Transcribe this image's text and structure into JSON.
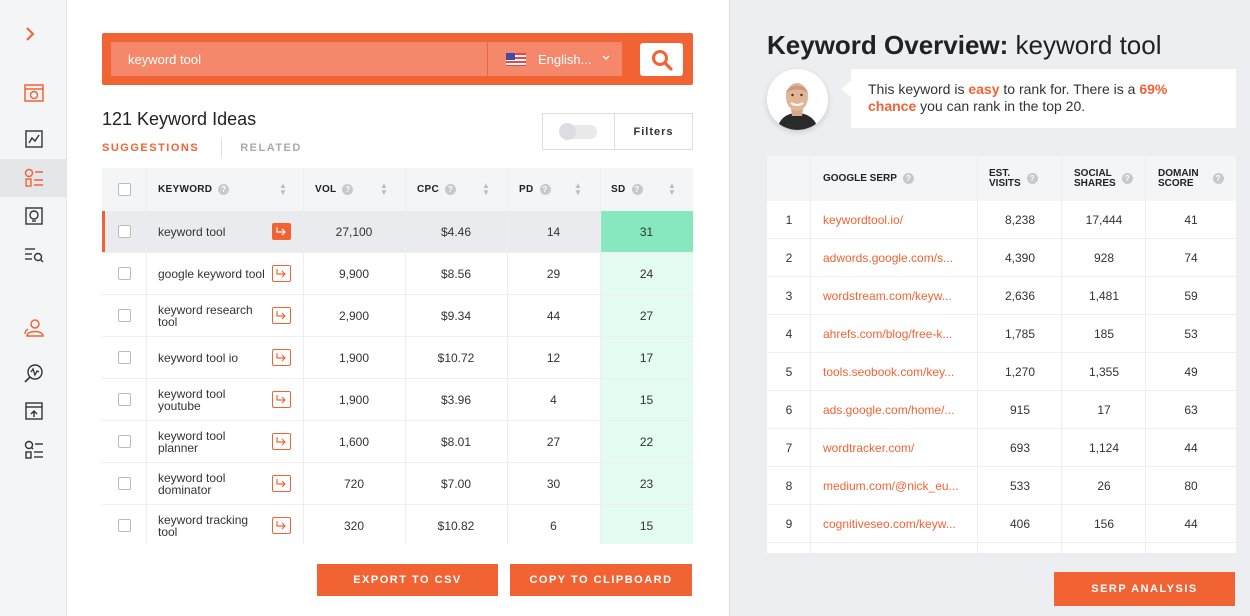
{
  "search": {
    "value": "keyword tool",
    "language": "English..."
  },
  "ideas": {
    "title": "121 Keyword Ideas",
    "tab_suggestions": "SUGGESTIONS",
    "tab_related": "RELATED",
    "filters_label": "Filters"
  },
  "table": {
    "headers": {
      "keyword": "KEYWORD",
      "vol": "VOL",
      "cpc": "CPC",
      "pd": "PD",
      "sd": "SD"
    },
    "rows": [
      {
        "keyword": "keyword tool",
        "vol": "27,100",
        "cpc": "$4.46",
        "pd": "14",
        "sd": "31"
      },
      {
        "keyword": "google keyword tool",
        "vol": "9,900",
        "cpc": "$8.56",
        "pd": "29",
        "sd": "24"
      },
      {
        "keyword": "keyword research tool",
        "vol": "2,900",
        "cpc": "$9.34",
        "pd": "44",
        "sd": "27"
      },
      {
        "keyword": "keyword tool io",
        "vol": "1,900",
        "cpc": "$10.72",
        "pd": "12",
        "sd": "17"
      },
      {
        "keyword": "keyword tool youtube",
        "vol": "1,900",
        "cpc": "$3.96",
        "pd": "4",
        "sd": "15"
      },
      {
        "keyword": "keyword tool planner",
        "vol": "1,600",
        "cpc": "$8.01",
        "pd": "27",
        "sd": "22"
      },
      {
        "keyword": "keyword tool dominator",
        "vol": "720",
        "cpc": "$7.00",
        "pd": "30",
        "sd": "23"
      },
      {
        "keyword": "keyword tracking tool",
        "vol": "320",
        "cpc": "$10.82",
        "pd": "6",
        "sd": "15"
      }
    ]
  },
  "buttons": {
    "export": "EXPORT TO CSV",
    "copy": "COPY TO CLIPBOARD",
    "serp": "SERP ANALYSIS"
  },
  "overview": {
    "title_bold": "Keyword Overview:",
    "title_term": " keyword tool",
    "msg_1": "This keyword is ",
    "msg_easy": "easy",
    "msg_2": " to rank for. There is a ",
    "msg_chance": "69% chance",
    "msg_3": " you can rank in the top 20."
  },
  "serp": {
    "headers": {
      "serp": "GOOGLE SERP",
      "visits_1": "EST.",
      "visits_2": "VISITS",
      "shares_1": "SOCIAL",
      "shares_2": "SHARES",
      "score_1": "DOMAIN",
      "score_2": "SCORE"
    },
    "rows": [
      {
        "n": "1",
        "url": "keywordtool.io/",
        "visits": "8,238",
        "shares": "17,444",
        "score": "41"
      },
      {
        "n": "2",
        "url": "adwords.google.com/s...",
        "visits": "4,390",
        "shares": "928",
        "score": "74"
      },
      {
        "n": "3",
        "url": "wordstream.com/keyw...",
        "visits": "2,636",
        "shares": "1,481",
        "score": "59"
      },
      {
        "n": "4",
        "url": "ahrefs.com/blog/free-k...",
        "visits": "1,785",
        "shares": "185",
        "score": "53"
      },
      {
        "n": "5",
        "url": "tools.seobook.com/key...",
        "visits": "1,270",
        "shares": "1,355",
        "score": "49"
      },
      {
        "n": "6",
        "url": "ads.google.com/home/...",
        "visits": "915",
        "shares": "17",
        "score": "63"
      },
      {
        "n": "7",
        "url": "wordtracker.com/",
        "visits": "693",
        "shares": "1,124",
        "score": "44"
      },
      {
        "n": "8",
        "url": "medium.com/@nick_eu...",
        "visits": "533",
        "shares": "26",
        "score": "80"
      },
      {
        "n": "9",
        "url": "cognitiveseo.com/keyw...",
        "visits": "406",
        "shares": "156",
        "score": "44"
      }
    ]
  },
  "colors": {
    "accent": "#f26334",
    "sd_highlight": "#87e7bf",
    "sd_cell": "#e3fbf0"
  }
}
